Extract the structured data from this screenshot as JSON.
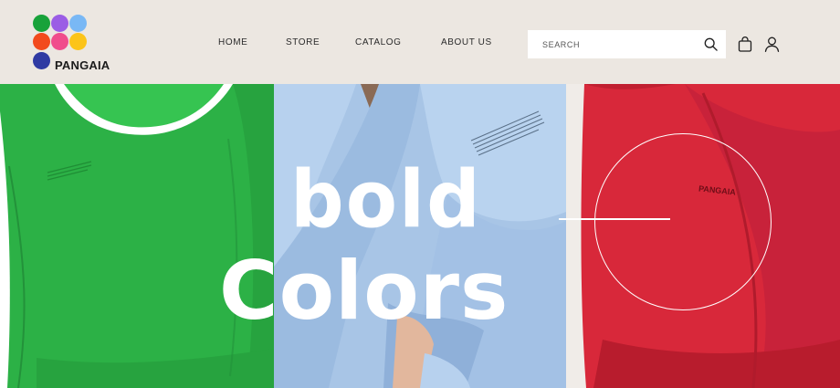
{
  "brand": {
    "name": "PANGAIA",
    "dot_colors": [
      "#18a23a",
      "#9b5de5",
      "#79b8f5",
      "#f24a1d",
      "#f04d8c",
      "#fcc419",
      "#2f3aa3"
    ]
  },
  "nav": {
    "items": [
      {
        "label": "HOME"
      },
      {
        "label": "STORE"
      },
      {
        "label": "CATALOG"
      },
      {
        "label": "ABOUT US"
      }
    ]
  },
  "search": {
    "placeholder": "SEARCH"
  },
  "icons": {
    "search": "search-icon",
    "bag": "bag-icon",
    "user": "user-icon"
  },
  "hero": {
    "line1": "bold",
    "line2": "Colors",
    "panels": [
      {
        "color": "#2fb447",
        "chest_print": "",
        "brand_print": ""
      },
      {
        "color": "#a9c6e6"
      },
      {
        "color": "#d72a3c",
        "brand_print": "PANGAIA"
      }
    ]
  }
}
